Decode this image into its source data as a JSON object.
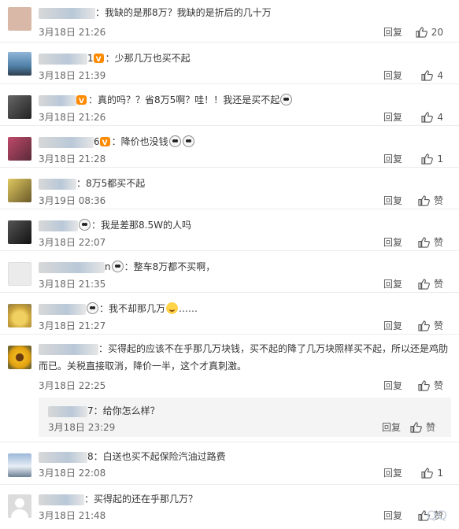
{
  "comments": [
    {
      "name_tail": "",
      "text": "：我缺的是那8万？我缺的是折后的几十万",
      "time": "3月18日 21:26",
      "reply": "回复",
      "likes": "20",
      "avatar": "#d9b8a8"
    },
    {
      "name_tail": "1",
      "text": "：少那几万也买不起",
      "time": "3月18日 21:39",
      "reply": "回复",
      "likes": "4",
      "avatar": "#4f7fa6"
    },
    {
      "name_tail": "",
      "text": "：真的吗？？省8万5啊？哇！！我还是买不起",
      "time": "3月18日 21:26",
      "reply": "回复",
      "likes": "4",
      "avatar": "#444444"
    },
    {
      "name_tail": "6",
      "text": "：降价也没钱",
      "time": "3月18日 21:28",
      "reply": "回复",
      "likes": "1",
      "avatar": "#7d3e4b"
    },
    {
      "name_tail": "",
      "text": "：8万5都买不起",
      "time": "3月19日 08:36",
      "reply": "回复",
      "likes": "赞",
      "avatar": "#9a8a3e"
    },
    {
      "name_tail": "",
      "text": "：我是差那8.5W的人吗",
      "time": "3月18日 22:07",
      "reply": "回复",
      "likes": "赞",
      "avatar": "#2e2e2e"
    },
    {
      "name_tail": "n",
      "text": "：整车8万都不买啊，",
      "time": "3月18日 21:35",
      "reply": "回复",
      "likes": "赞",
      "avatar": "#e6e6e6"
    },
    {
      "name_tail": "",
      "text": "：我不却那几万",
      "time": "3月18日 21:27",
      "reply": "回复",
      "likes": "赞",
      "avatar": "#e8c44b"
    },
    {
      "name_tail": "",
      "text": "：买得起的应该不在乎那几万块钱，买不起的降了几万块照样买不起，所以还是鸡肋而已。关税直接取消，降价一半，这个才真刺激。",
      "time": "3月18日 22:25",
      "reply": "回复",
      "likes": "赞",
      "avatar": "#d9a21a"
    },
    {
      "name_tail": "8",
      "text": "：白送也买不起保险汽油过路费",
      "time": "3月18日 22:08",
      "reply": "回复",
      "likes": "1",
      "avatar": "#6b8fb8"
    },
    {
      "name_tail": "",
      "text": "：买得起的还在乎那几万？",
      "time": "3月18日 21:48",
      "reply": "回复",
      "likes": "赞",
      "avatar": "#d8d8d8"
    }
  ],
  "subreply": {
    "name_tail": "7",
    "text": "：给你怎么样？",
    "time": "3月18日 23:29",
    "reply": "回复",
    "likes": "赞"
  },
  "watermark": "QQ"
}
